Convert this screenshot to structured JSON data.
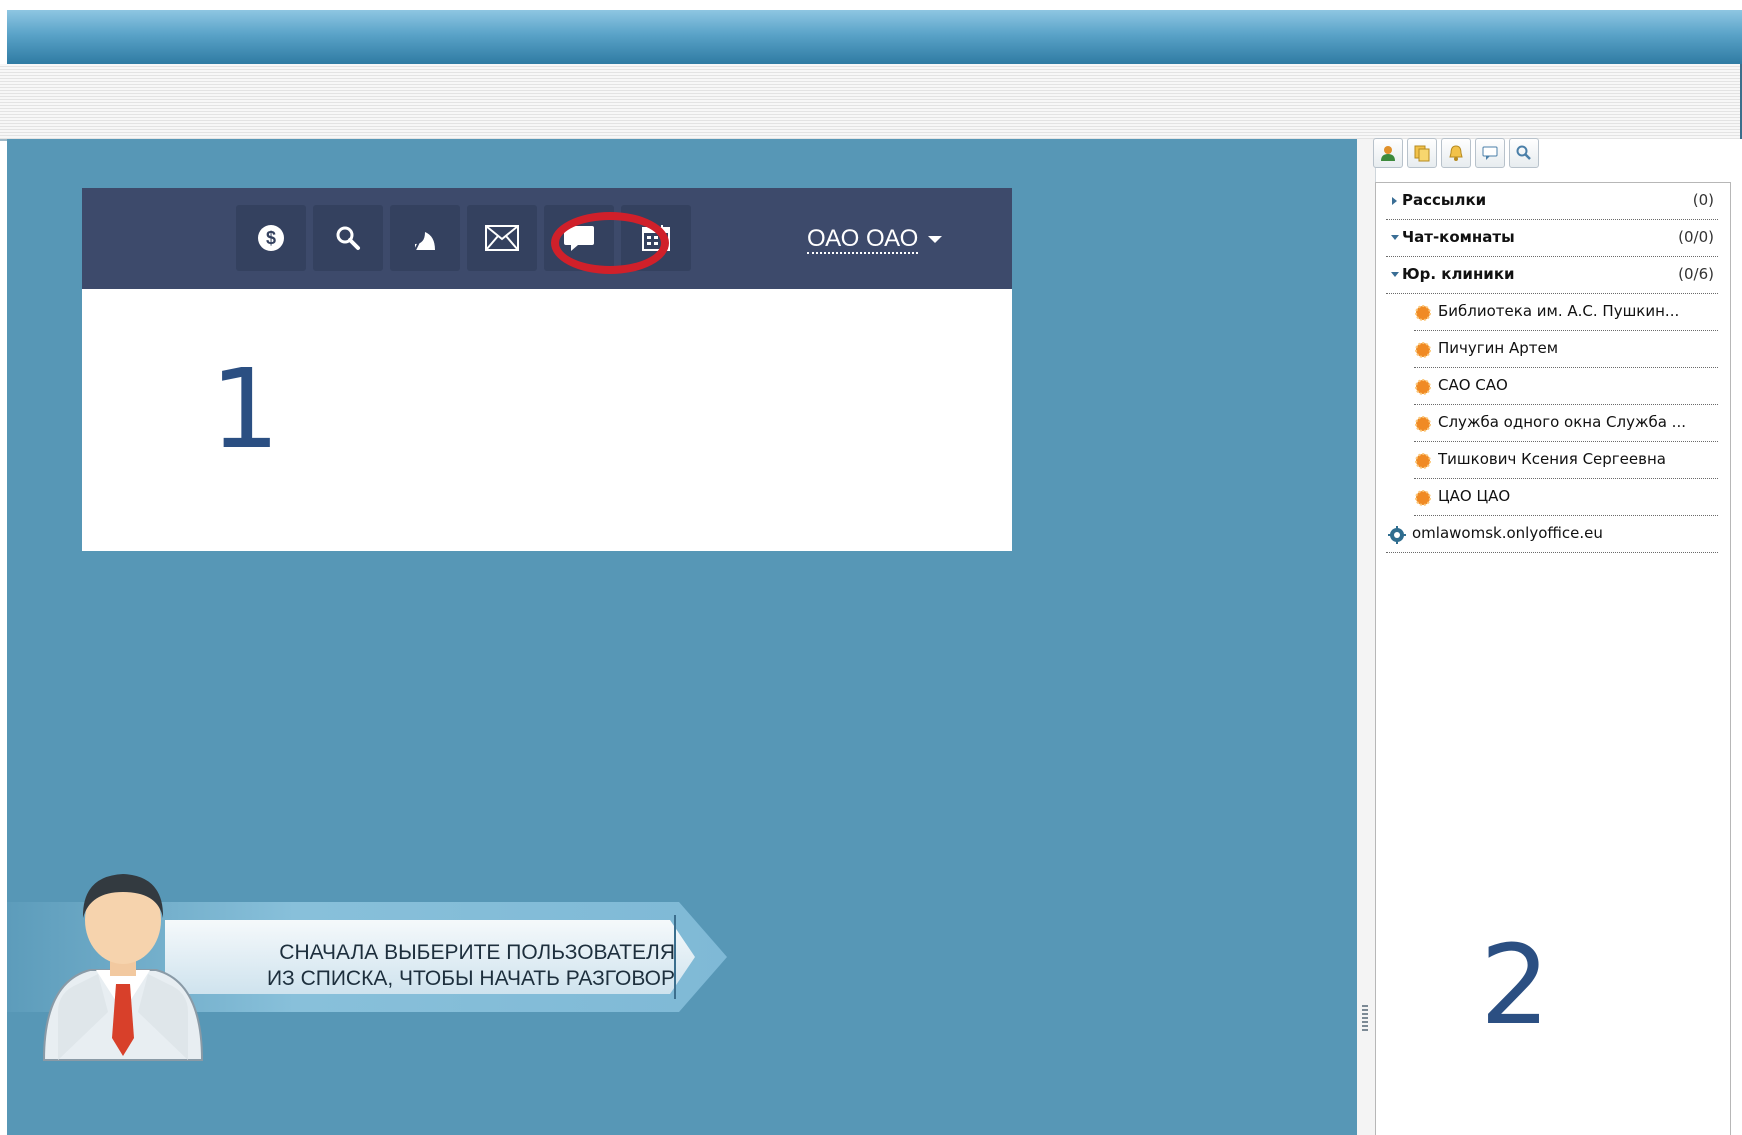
{
  "inset_header": {
    "user_name": "ОАО ОАО",
    "icons": [
      "balance-icon",
      "search-icon",
      "feed-icon",
      "mail-icon",
      "chat-icon",
      "calendar-icon"
    ],
    "highlighted_icon": "chat-icon",
    "highlight_color": "#d0202a"
  },
  "markers": {
    "one": "1",
    "two": "2"
  },
  "banner": {
    "line1": "СНАЧАЛА ВЫБЕРИТЕ ПОЛЬЗОВАТЕЛЯ",
    "line2": "ИЗ СПИСКА, ЧТОБЫ НАЧАТЬ РАЗГОВОР"
  },
  "sidebar": {
    "toolbar_icons": [
      "contacts-icon",
      "add-group-icon",
      "alert-icon",
      "message-icon",
      "search-icon"
    ],
    "groups": [
      {
        "label": "Рассылки",
        "count": "(0)",
        "expanded": false
      },
      {
        "label": "Чат-комнаты",
        "count": "(0/0)",
        "expanded": true
      },
      {
        "label": "Юр. клиники",
        "count": "(0/6)",
        "expanded": true
      }
    ],
    "contacts": [
      "Библиотека им. А.С. Пушкин...",
      "Пичугин Артем",
      "САО САО",
      "Служба одного окна Служба ...",
      "Тишкович Ксения Сергеевна",
      "ЦАО ЦАО"
    ],
    "server": "omlawomsk.onlyoffice.eu"
  },
  "colors": {
    "background": "#5797b6",
    "header": "#3d4a6b",
    "marker": "#2b4f82",
    "status_offline": "#f08a24"
  }
}
